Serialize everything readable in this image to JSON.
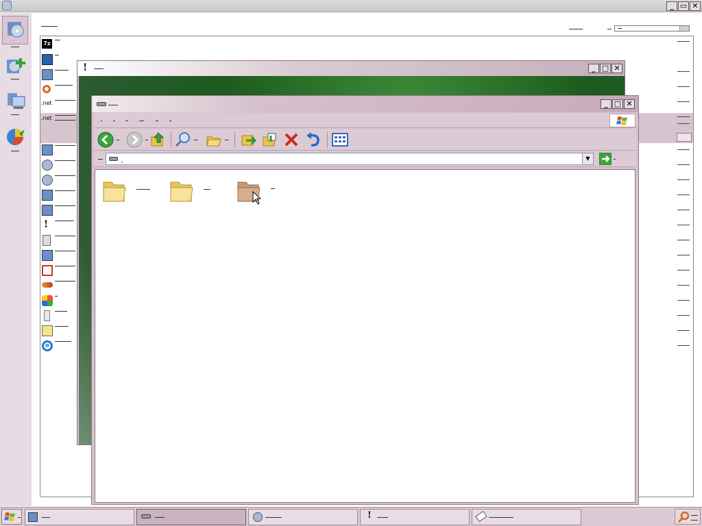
{
  "desktop": {
    "title_bar_caption": "",
    "window_buttons": [
      "_",
      "▭",
      "✕"
    ],
    "search_label": "",
    "sidebar_tools": [
      "tool-1",
      "tool-2",
      "tool-3",
      "tool-4"
    ],
    "list_items": [
      {
        "icon": "7z-icon",
        "label": ""
      },
      {
        "icon": "window-icon",
        "label": ""
      },
      {
        "icon": "setup-icon",
        "label": ""
      },
      {
        "icon": "magnifier-icon",
        "label": ""
      },
      {
        "icon": "net-icon",
        "label": ""
      },
      {
        "icon": "net-icon",
        "label": ""
      },
      {
        "icon": "setup-icon",
        "label": ""
      },
      {
        "icon": "cd-icon",
        "label": ""
      },
      {
        "icon": "cd-icon",
        "label": ""
      },
      {
        "icon": "setup-icon",
        "label": ""
      },
      {
        "icon": "setup-icon",
        "label": ""
      },
      {
        "icon": "exclamation-icon",
        "label": ""
      },
      {
        "icon": "disk-icon",
        "label": ""
      },
      {
        "icon": "setup-icon",
        "label": ""
      },
      {
        "icon": "media-icon",
        "label": ""
      },
      {
        "icon": "link-icon",
        "label": ""
      },
      {
        "icon": "color-icon",
        "label": ""
      },
      {
        "icon": "tower-icon",
        "label": ""
      },
      {
        "icon": "notepad-icon",
        "label": ""
      },
      {
        "icon": "ie-icon",
        "label": ""
      }
    ]
  },
  "explorer": {
    "title": "",
    "menu": [
      "",
      "",
      "",
      "",
      "",
      ""
    ],
    "address": "",
    "go_label": "",
    "folders": [
      {
        "name": "",
        "state": "normal"
      },
      {
        "name": "",
        "state": "normal"
      },
      {
        "name": "",
        "state": "selected"
      }
    ]
  },
  "behind_window": {
    "title": ""
  },
  "taskbar": {
    "items": [
      "",
      "",
      "",
      "",
      ""
    ]
  },
  "colors": {
    "titlebar_active": "#c9a9b9",
    "sidebar_bg": "#e7dce3",
    "desktop_gradient": "#1f5e20",
    "selected_row": "#d7c4cf"
  }
}
